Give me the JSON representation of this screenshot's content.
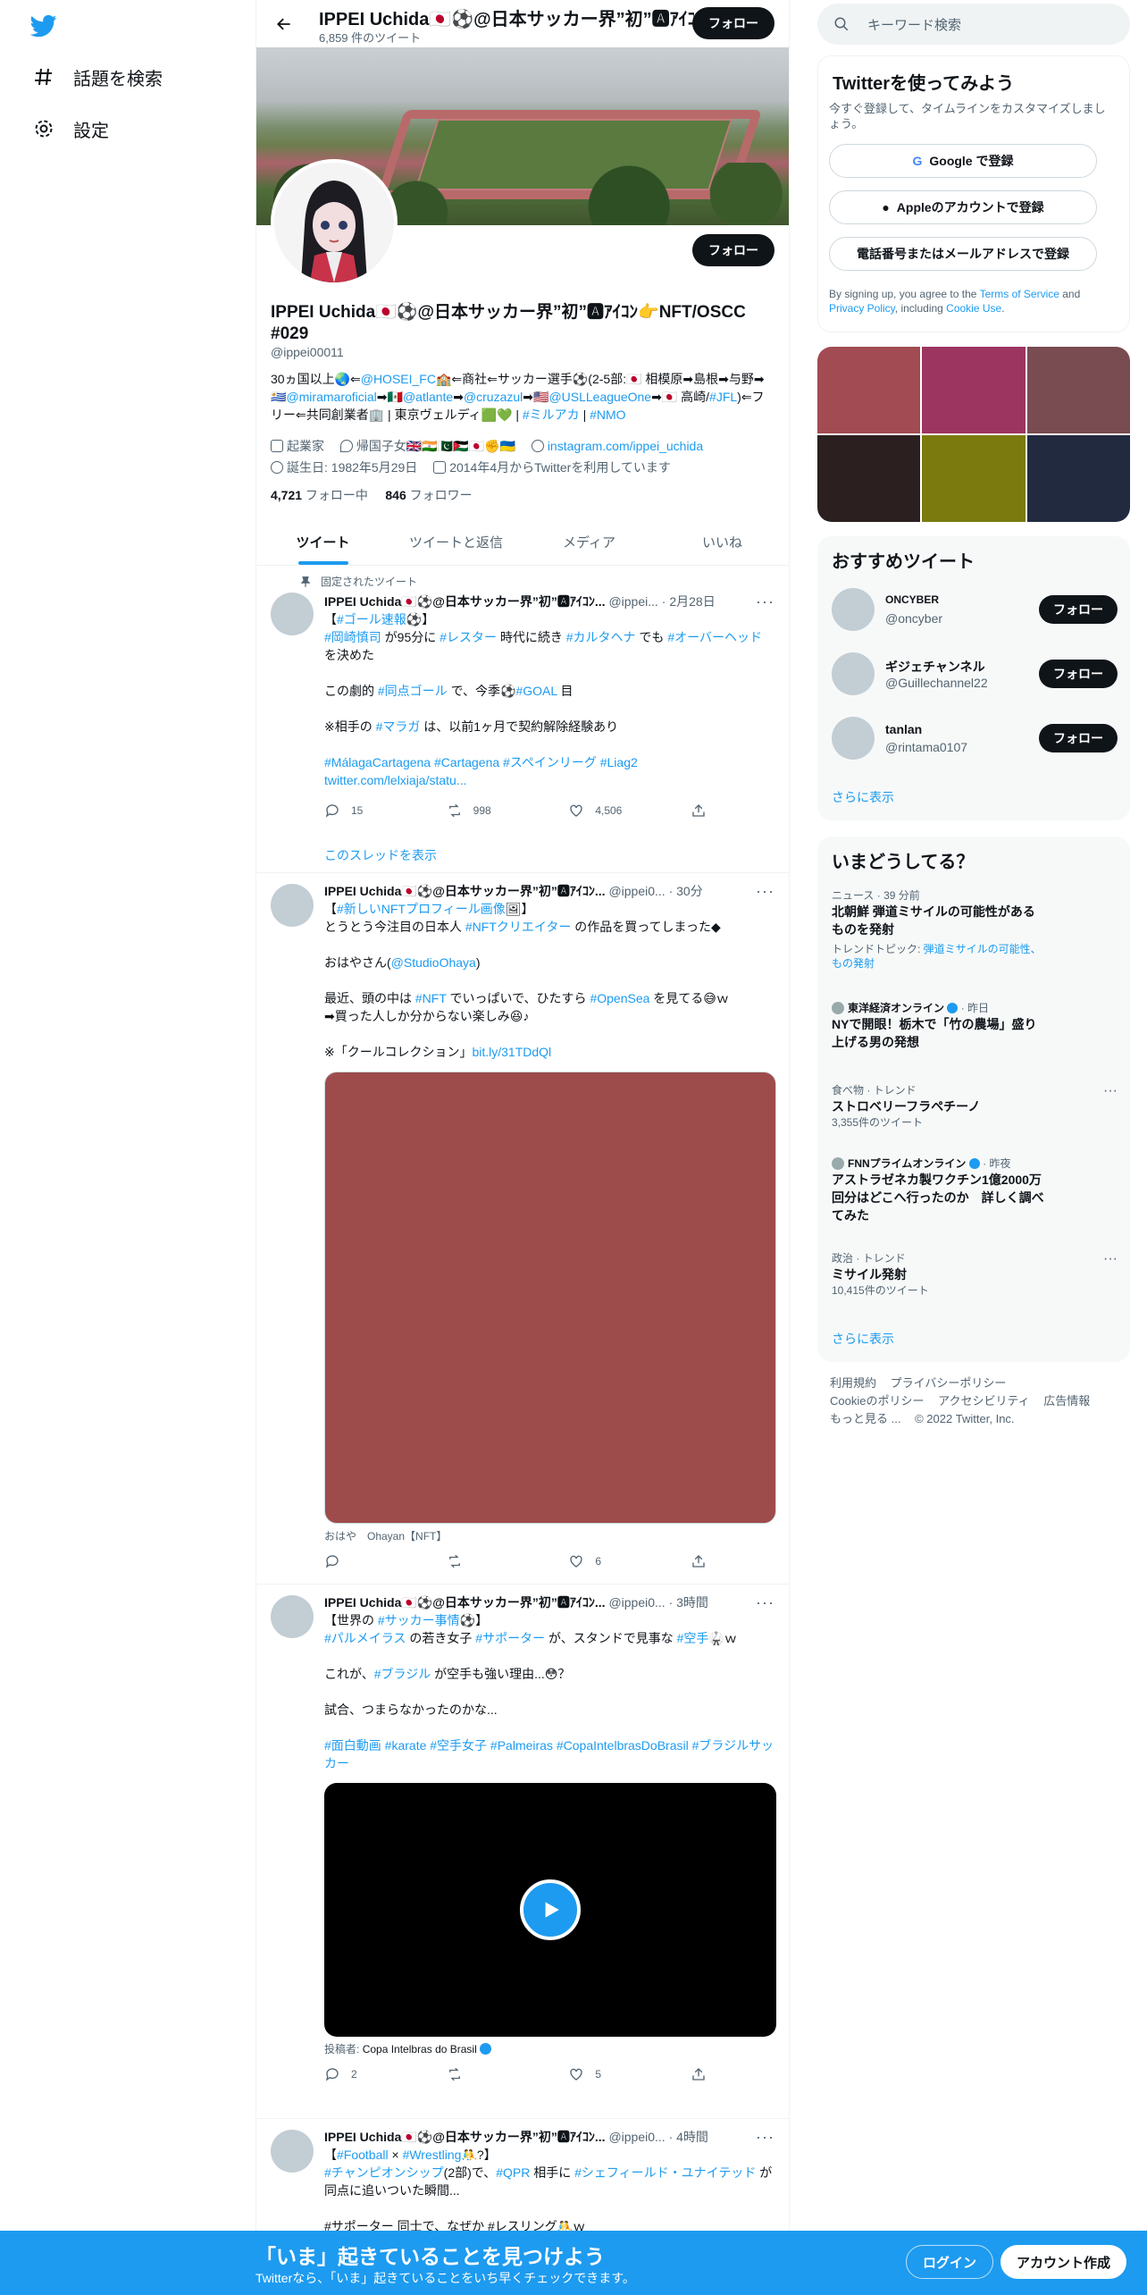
{
  "nav": {
    "explore": "話題を検索",
    "settings": "設定"
  },
  "topbar": {
    "title": "IPPEI Uchida🇯🇵⚽@日本サッカー界”初”🅰ｱｲｺﾝ",
    "tweet_count": "6,859 件のツイート",
    "follow": "フォロー"
  },
  "profile": {
    "follow": "フォロー",
    "name": "IPPEI Uchida🇯🇵⚽@日本サッカー界”初”🅰ｱｲｺﾝ👉NFT/OSCC #029",
    "handle": "@ippei00011",
    "bio_1": "30ヵ国以上🌏⇐",
    "bio_link_1": "@HOSEI_FC",
    "bio_2": "🏫⇐商社⇐サッカー選手⚽(2-5部:🇯🇵 相模原➡島根➡与野➡🇺🇾",
    "bio_link_2": "@miramaroficial",
    "bio_3": "➡🇲🇽",
    "bio_link_3": "@atlante",
    "bio_4": "➡",
    "bio_link_4": "@cruzazul",
    "bio_5": "➡🇺🇸",
    "bio_link_5": "@USLLeagueOne",
    "bio_6": "➡🇯🇵 高崎/",
    "bio_link_6": "#JFL",
    "bio_7": ")⇐フリー⇐共同創業者🏢 | 東京ヴェルディ🟩💚 | ",
    "bio_link_7": "#ミルアカ",
    "bio_8": " | ",
    "bio_link_8": "#NMO",
    "occupation": "起業家",
    "location": "帰国子女🇬🇧🇮🇳🇵🇰🇯🇴🇯🇵✊🇺🇦",
    "website": "instagram.com/ippei_uchida",
    "birthday": "誕生日: 1982年5月29日",
    "joined": "2014年4月からTwitterを利用しています",
    "following_count": "4,721",
    "following_label": "フォロー中",
    "followers_count": "846",
    "followers_label": "フォロワー"
  },
  "tabs": [
    "ツイート",
    "ツイートと返信",
    "メディア",
    "いいね"
  ],
  "tweets": [
    {
      "pinned_label": "固定されたツイート",
      "name": "IPPEI Uchida🇯🇵⚽@日本サッカー界”初”🅰ｱｲｺﾝ...",
      "handle": "@ippei...",
      "time": "· 2月28日",
      "l1a": "【",
      "l1b": "#ゴール速報",
      "l1c": "⚽】",
      "l2a": "#岡崎慎司",
      "l2b": " が95分に ",
      "l2c": "#レスター",
      "l2d": " 時代に続き ",
      "l2e": "#カルタヘナ",
      "l2f": " でも ",
      "l2g": "#オーバーヘッド",
      "l2h": " を決めた",
      "p2a": "この劇的 ",
      "p2b": "#同点ゴール",
      "p2c": " で、今季⚽",
      "p2d": "#GOAL",
      "p2e": " 目",
      "p3a": "※相手の ",
      "p3b": "#マラガ",
      "p3c": " は、以前1ヶ月で契約解除経験あり",
      "tags": "#MálagaCartagena #Cartagena #スペインリーグ #Liag2",
      "link": "twitter.com/lelxiaja/statu...",
      "replies": "15",
      "retweets": "998",
      "likes": "4,506",
      "thread": "このスレッドを表示"
    },
    {
      "name": "IPPEI Uchida🇯🇵⚽@日本サッカー界”初”🅰ｱｲｺﾝ...",
      "handle": "@ippei0...",
      "time": "· 30分",
      "l1a": "【",
      "l1b": "#新しいNFTプロフィール画像",
      "l1c": "🖼】",
      "l2a": "とうとう今注目の日本人 ",
      "l2b": "#NFTクリエイター",
      "l2c": " の作品を買ってしまった◆",
      "p2a": "おはやさん(",
      "p2b": "@StudioOhaya",
      "p2c": ")",
      "p3a": "最近、頭の中は ",
      "p3b": "#NFT",
      "p3c": " でいっぱいで、ひたすら ",
      "p3d": "#OpenSea",
      "p3e": " を見てる😅ｗ",
      "p3f": "➡買った人しか分からない楽しみ😆♪",
      "p4a": "※「クールコレクション」",
      "p4b": "bit.ly/31TDdQl",
      "caption": "おはや　Ohayan【NFT】",
      "replies": "",
      "retweets": "",
      "likes": "6"
    },
    {
      "name": "IPPEI Uchida🇯🇵⚽@日本サッカー界”初”🅰ｱｲｺﾝ...",
      "handle": "@ippei0...",
      "time": "· 3時間",
      "l1a": "【世界の ",
      "l1b": "#サッカー事情",
      "l1c": "⚽】",
      "l2a": "#パルメイラス",
      "l2b": " の若き女子 ",
      "l2c": "#サポーター",
      "l2d": " が、スタンドで見事な ",
      "l2e": "#空手",
      "l2f": "🥋ｗ",
      "p2": "これが、#ブラジル が空手も強い理由...😳？",
      "p2a": "これが、",
      "p2b": "#ブラジル",
      "p2c": " が空手も強い理由...😳？",
      "p3": "試合、つまらなかったのかな...",
      "tags": "#面白動画 #karate #空手女子 #Palmeiras #CopaIntelbrasDoBrasil #ブラジルサッカー",
      "poster_label": "投稿者:",
      "poster": "Copa Intelbras do Brasil",
      "replies": "2",
      "retweets": "",
      "likes": "5"
    },
    {
      "name": "IPPEI Uchida🇯🇵⚽@日本サッカー界”初”🅰ｱｲｺﾝ...",
      "handle": "@ippei0...",
      "time": "· 4時間",
      "l1a": "【",
      "l1b": "#Football",
      "l1c": " × ",
      "l1d": "#Wrestling",
      "l1e": "🤼?】",
      "l2a": "#チャンピオンシップ",
      "l2b": "(2部)で、",
      "l2c": "#QPR",
      "l2d": " 相手に ",
      "l2e": "#シェフィールド・ユナイテッド",
      "l2f": " が同点に追いついた瞬間...",
      "l3": "#サポーター 同士で、なぜか #レスリング🤼ｗ"
    }
  ],
  "right": {
    "search_placeholder": "キーワード検索",
    "signup_title": "Twitterを使ってみよう",
    "signup_sub": "今すぐ登録して、タイムラインをカスタマイズしましょう。",
    "google": "Google で登録",
    "apple": "Appleのアカウントで登録",
    "phone": "電話番号またはメールアドレスで登録",
    "terms_1": "By signing up, you agree to the ",
    "terms_link_1": "Terms of Service",
    "terms_2": " and ",
    "terms_link_2": "Privacy Policy",
    "terms_3": ", including ",
    "terms_link_3": "Cookie Use",
    "terms_4": ".",
    "media_colors": [
      "#a24b52",
      "#9c3560",
      "#784c50",
      "#2b1f1f",
      "#7a7a0e",
      "#222a40"
    ],
    "rec_title": "おすすめツイート",
    "recs": [
      {
        "name": "ONCYBER",
        "handle": "@oncyber"
      },
      {
        "name": "ギジェチャンネル",
        "handle": "@Guillechannel22"
      },
      {
        "name": "tanlan",
        "handle": "@rintama0107"
      }
    ],
    "rec_follow": "フォロー",
    "show_more": "さらに表示",
    "trends_title": "いまどうしてる？",
    "trend1_cat": "ニュース · 39 分前",
    "trend1_title": "北朝鮮 弾道ミサイルの可能性があるものを発射",
    "trend1_topic_label": "トレンドトピック: ",
    "trend1_topic": "弾道ミサイルの可能性、もの発射",
    "trend2_source": "東洋経済オンライン",
    "trend2_time": " · 昨日",
    "trend2_title": "NYで開眼！栃木で「竹の農場」盛り上げる男の発想",
    "trend3_cat": "食べ物 · トレンド",
    "trend3_title": "ストロベリーフラペチーノ",
    "trend3_count": "3,355件のツイート",
    "trend4_source": "FNNプライムオンライン",
    "trend4_time": " · 昨夜",
    "trend4_title": "アストラゼネカ製ワクチン1億2000万回分はどこへ行ったのか　詳しく調べてみた",
    "trend5_cat": "政治 · トレンド",
    "trend5_title": "ミサイル発射",
    "trend5_count": "10,415件のツイート",
    "footer": [
      "利用規約",
      "プライバシーポリシー",
      "Cookieのポリシー",
      "アクセシビリティ",
      "広告情報",
      "もっと見る ...",
      "© 2022 Twitter, Inc."
    ]
  },
  "bottom": {
    "title": "「いま」起きていることを見つけよう",
    "sub": "Twitterなら、「いま」起きていることをいち早くチェックできます。",
    "login": "ログイン",
    "signup": "アカウント作成"
  },
  "colors": {
    "accent": "#1d9bf0",
    "primary_text": "#0f1419",
    "secondary_text": "#536471"
  }
}
